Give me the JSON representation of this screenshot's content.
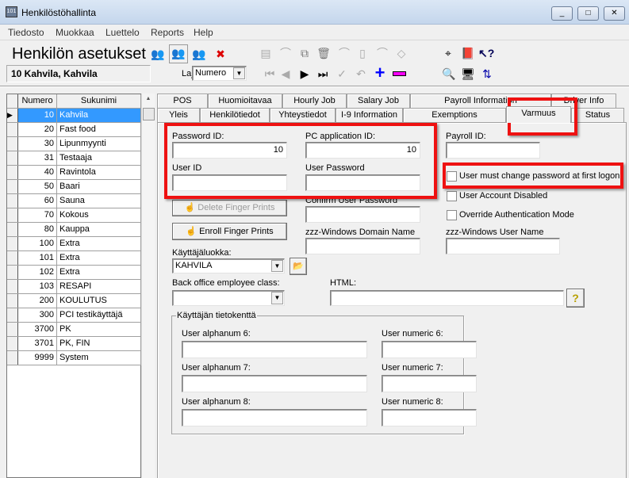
{
  "window": {
    "title": "Henkilöstöhallinta",
    "controls": [
      "_",
      "□",
      "✕"
    ]
  },
  "menu": [
    "Tiedosto",
    "Muokkaa",
    "Luettelo",
    "Reports",
    "Help"
  ],
  "header": {
    "title": "Henkilön asetukset",
    "record": "10  Kahvila, Kahvila",
    "sort_label": "Lajittelu:",
    "sort_value": "Numero"
  },
  "grid": {
    "columns": [
      "Numero",
      "Sukunimi"
    ],
    "rows": [
      [
        "10",
        "Kahvila"
      ],
      [
        "20",
        "Fast food"
      ],
      [
        "30",
        "Lipunmyynti"
      ],
      [
        "31",
        "Testaaja"
      ],
      [
        "40",
        "Ravintola"
      ],
      [
        "50",
        "Baari"
      ],
      [
        "60",
        "Sauna"
      ],
      [
        "70",
        "Kokous"
      ],
      [
        "80",
        "Kauppa"
      ],
      [
        "100",
        "Extra"
      ],
      [
        "101",
        "Extra"
      ],
      [
        "102",
        "Extra"
      ],
      [
        "103",
        "RESAPI"
      ],
      [
        "200",
        "KOULUTUS"
      ],
      [
        "300",
        "PCI testikäyttäjä"
      ],
      [
        "3700",
        "PK"
      ],
      [
        "3701",
        "PK, FIN"
      ],
      [
        "9999",
        "System"
      ]
    ],
    "selected_index": 0
  },
  "tabs_row1": [
    "POS",
    "Huomioitavaa",
    "Hourly Job",
    "Salary Job",
    "Payroll Information",
    "Driver Info"
  ],
  "tabs_row2": [
    "Yleis",
    "Henkilötiedot",
    "Yhteystiedot",
    "I-9 Information",
    "Exemptions",
    "Varmuus",
    "Status"
  ],
  "active_tab": "Varmuus",
  "form": {
    "password_id_label": "Password ID:",
    "password_id": "10",
    "pc_app_id_label": "PC application ID:",
    "pc_app_id": "10",
    "payroll_id_label": "Payroll ID:",
    "payroll_id": "",
    "user_id_label": "User ID",
    "user_id": "",
    "user_password_label": "User Password",
    "user_password": "",
    "confirm_password_label": "Confirm User Password",
    "must_change_label": "User must change password at first logon",
    "must_change": false,
    "disabled_label": "User Account Disabled",
    "disabled": false,
    "override_label": "Override Authentication Mode",
    "override": false,
    "delete_fp": "Delete Finger Prints",
    "enroll_fp": "Enroll Finger Prints",
    "domain_label": "zzz-Windows Domain Name",
    "win_user_label": "zzz-Windows User Name",
    "user_class_label": "Käyttäjäluokka:",
    "user_class": "KAHVILA",
    "back_office_label": "Back office employee class:",
    "back_office": "",
    "html_label": "HTML:",
    "html": "",
    "help_button": "?",
    "group_title": "Käyttäjän tietokenttä",
    "alpha6": "User alphanum 6:",
    "alpha7": "User alphanum 7:",
    "alpha8": "User alphanum 8:",
    "num6": "User numeric 6:",
    "num7": "User numeric 7:",
    "num8": "User numeric 8:"
  },
  "colors": {
    "highlight": "#3399ff",
    "annotation": "#e11111"
  }
}
